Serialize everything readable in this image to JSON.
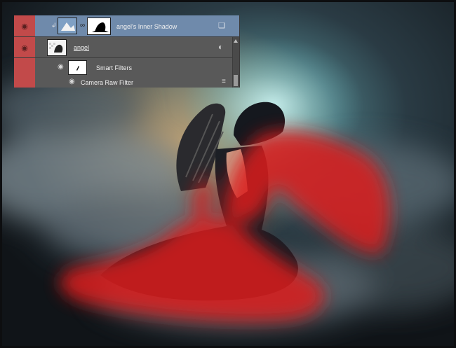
{
  "layers_panel": {
    "layers": [
      {
        "name": "angel's Inner Shadow",
        "selected": true,
        "icon": "layer-style-icon"
      },
      {
        "name": "angel",
        "selected": false,
        "icon": "smart-object-icon"
      },
      {
        "name": "Smart Filters",
        "selected": false,
        "icon": "filter-mask-icon"
      },
      {
        "name": "Camera Raw Filter",
        "selected": false,
        "icon": "filter-options-icon"
      }
    ]
  },
  "colors": {
    "visibility_column": "#c24a4a",
    "selected_row": "#6f8aab",
    "quick_mask_overlay": "#dc1e1e"
  }
}
